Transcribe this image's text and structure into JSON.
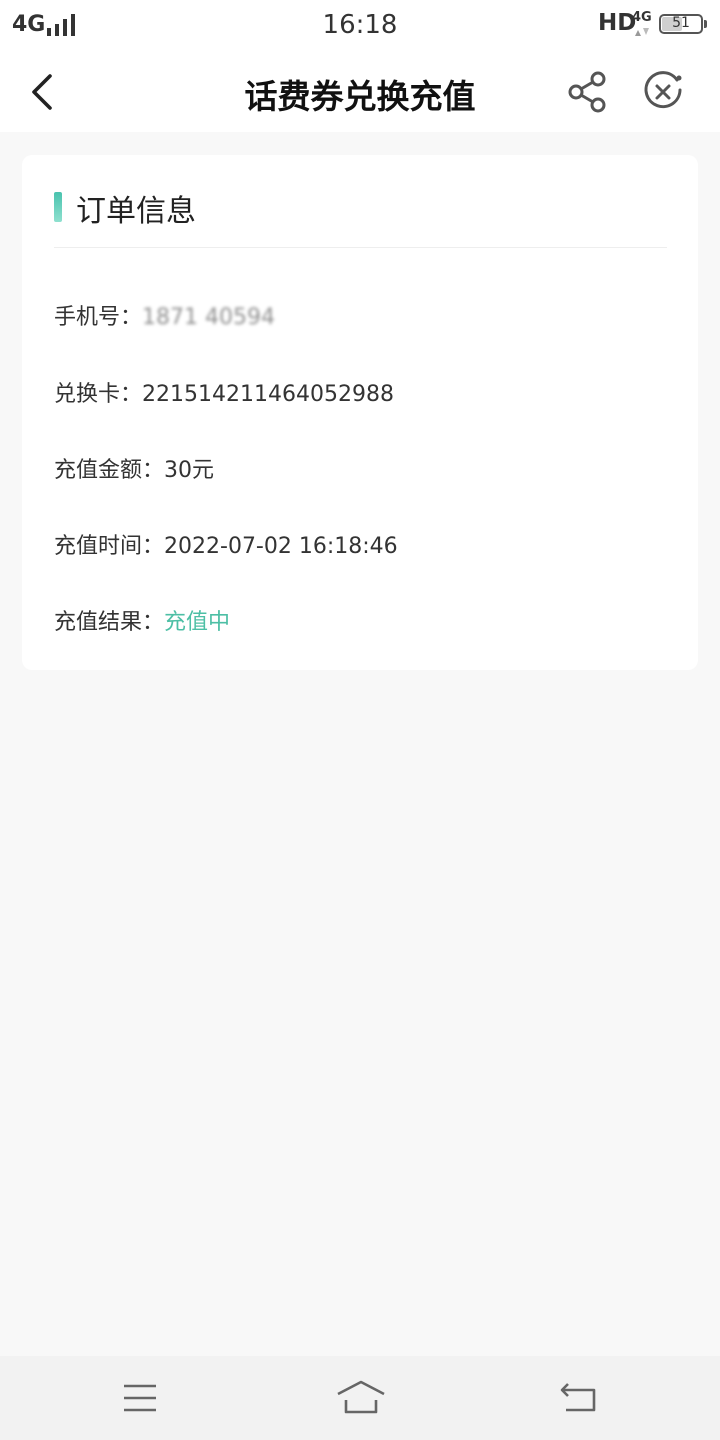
{
  "status_bar": {
    "network": "4G",
    "time": "16:18",
    "hd": "HD",
    "net_type": "4G",
    "battery": "51",
    "battery_level": 0.51
  },
  "header": {
    "title": "话费券兑换充值",
    "back_icon": "chevron-left-icon",
    "share_icon": "share-icon",
    "close_icon": "close-circle-icon"
  },
  "order": {
    "section_title": "订单信息",
    "phone_label": "手机号：",
    "phone_value": "1871 40594",
    "card_label": "兑换卡：",
    "card_value": "221514211464052988",
    "amount_label": "充值金额：",
    "amount_value": "30元",
    "time_label": "充值时间：",
    "time_value": "2022-07-02 16:18:46",
    "result_label": "充值结果：",
    "result_value": "充值中"
  },
  "colors": {
    "accent": "#4dbfa5",
    "background": "#f8f8f8"
  },
  "system_nav": {
    "menu_icon": "menu-icon",
    "home_icon": "home-icon",
    "back_icon": "back-arrow-icon"
  }
}
